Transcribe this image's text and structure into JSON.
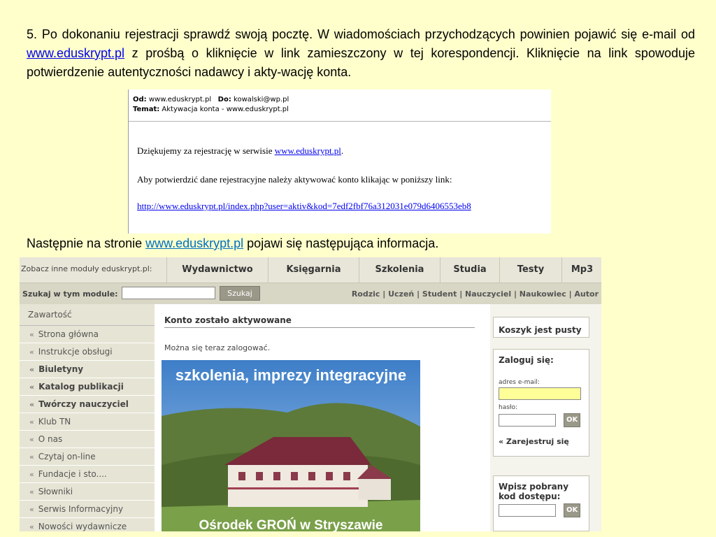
{
  "step": {
    "text_before": "5. Po dokonaniu rejestracji sprawdź swoją pocztę. W wiadomościach przychodzących powinien pojawić się e-mail od ",
    "link": "www.eduskrypt.pl",
    "text_after": " z prośbą o kliknięcie w link zamieszczony w tej korespondencji. Kliknięcie na link spowoduje potwierdzenie autentyczności nadawcy i akty-wację konta."
  },
  "email": {
    "from_label": "Od:",
    "from": "www.eduskrypt.pl",
    "to_label": "Do:",
    "to": "kowalski@wp.pl",
    "subject_label": "Temat:",
    "subject": "Aktywacja konta - www.eduskrypt.pl",
    "line1_before": "Dziękujemy za rejestrację w serwisie ",
    "line1_link": "www.eduskrypt.pl",
    "line1_after": ".",
    "line2": "Aby potwierdzić dane rejestracyjne należy aktywować konto klikając w poniższy link:",
    "activation_link": "http://www.eduskrypt.pl/index.php?user=aktiv&kod=7edf2fbf76a312031e079d6406553eb8"
  },
  "next": {
    "text_before": "Następnie na stronie ",
    "link": "www.eduskrypt.pl",
    "text_after": " pojawi się następująca informacja."
  },
  "site": {
    "modules_label": "Zobacz inne moduły eduskrypt.pl:",
    "tabs": [
      "Wydawnictwo",
      "Księgarnia",
      "Szkolenia",
      "Studia",
      "Testy",
      "Mp3"
    ],
    "search_label": "Szukaj w tym module:",
    "search_button": "Szukaj",
    "roles": "Rodzic | Uczeń | Student | Nauczyciel | Naukowiec | Autor",
    "sidebar_title": "Zawartość",
    "sidebar_items": [
      {
        "label": "Strona główna",
        "bold": false
      },
      {
        "label": "Instrukcje obsługi",
        "bold": false
      },
      {
        "label": "Biuletyny",
        "bold": true
      },
      {
        "label": "Katalog publikacji",
        "bold": true
      },
      {
        "label": "Twórczy nauczyciel",
        "bold": true
      },
      {
        "label": "Klub TN",
        "bold": false
      },
      {
        "label": "O nas",
        "bold": false
      },
      {
        "label": "Czytaj on-line",
        "bold": false
      },
      {
        "label": "Fundacje i sto....",
        "bold": false
      },
      {
        "label": "Słowniki",
        "bold": false
      },
      {
        "label": "Serwis Informacyjny",
        "bold": false
      },
      {
        "label": "Nowości wydawnicze",
        "bold": false
      }
    ],
    "content_heading": "Konto zostało aktywowane",
    "content_sub": "Można się teraz zalogować.",
    "photo_caption_top": "szkolenia, imprezy integracyjne",
    "photo_caption_bottom": "Ośrodek GROŃ w Stryszawie",
    "cart": "Koszyk jest pusty",
    "login_title": "Zaloguj się:",
    "email_label": "adres e-mail:",
    "password_label": "hasło:",
    "ok": "OK",
    "register": "« Zarejestruj się",
    "code_title": "Wpisz pobrany kod dostępu:",
    "ok2": "OK"
  }
}
